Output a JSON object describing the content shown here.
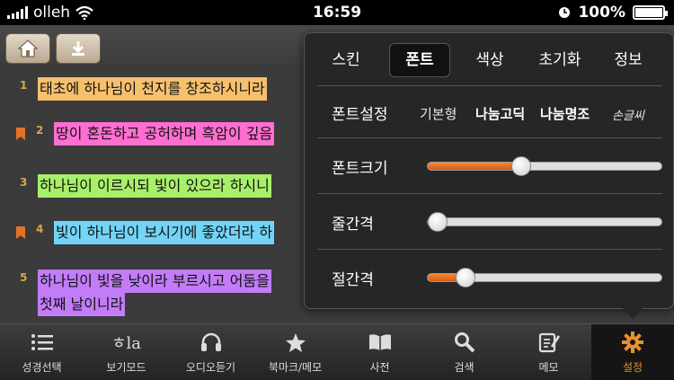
{
  "status": {
    "carrier": "olleh",
    "time": "16:59",
    "battery": "100%"
  },
  "verses": [
    {
      "num": "1",
      "text": "태초에 하나님이 천지를 창조하시니라",
      "color": "#f7c06e",
      "bookmark": false
    },
    {
      "num": "2",
      "text": "땅이 혼돈하고 공허하며 흑암이 깊음",
      "color": "#ff6fd2",
      "bookmark": true
    },
    {
      "num": "3",
      "text": "하나님이 이르시되 빛이 있으라 하시니",
      "color": "#a8f06a",
      "bookmark": false
    },
    {
      "num": "4",
      "text": "빛이 하나님이 보시기에 좋았더라 하",
      "color": "#72d4f7",
      "bookmark": true
    },
    {
      "num": "5",
      "text": "하나님이 빛을 낮이라 부르시고 어둠을",
      "text2": "첫째 날이니라",
      "color": "#c27cf7",
      "bookmark": false
    }
  ],
  "popup": {
    "tabs": [
      "스킨",
      "폰트",
      "색상",
      "초기화",
      "정보"
    ],
    "active_tab": "폰트",
    "font_setting_label": "폰트설정",
    "font_options": [
      "기본형",
      "나눔고딕",
      "나눔명조",
      "손글씨"
    ],
    "selected_font": "나눔고딕",
    "font_size_label": "폰트크기",
    "line_spacing_label": "줄간격",
    "paragraph_spacing_label": "절간격",
    "font_size_level": 0.4,
    "line_spacing_level": 0.0,
    "paragraph_spacing_level": 0.16
  },
  "toolbar": {
    "items": [
      "성경선택",
      "보기모드",
      "오디오듣기",
      "북마크/메모",
      "사전",
      "검색",
      "메모",
      "설정"
    ],
    "active": "설정"
  },
  "colors": {
    "accent": "#e8902e",
    "slider_fill": "#e0661a"
  }
}
